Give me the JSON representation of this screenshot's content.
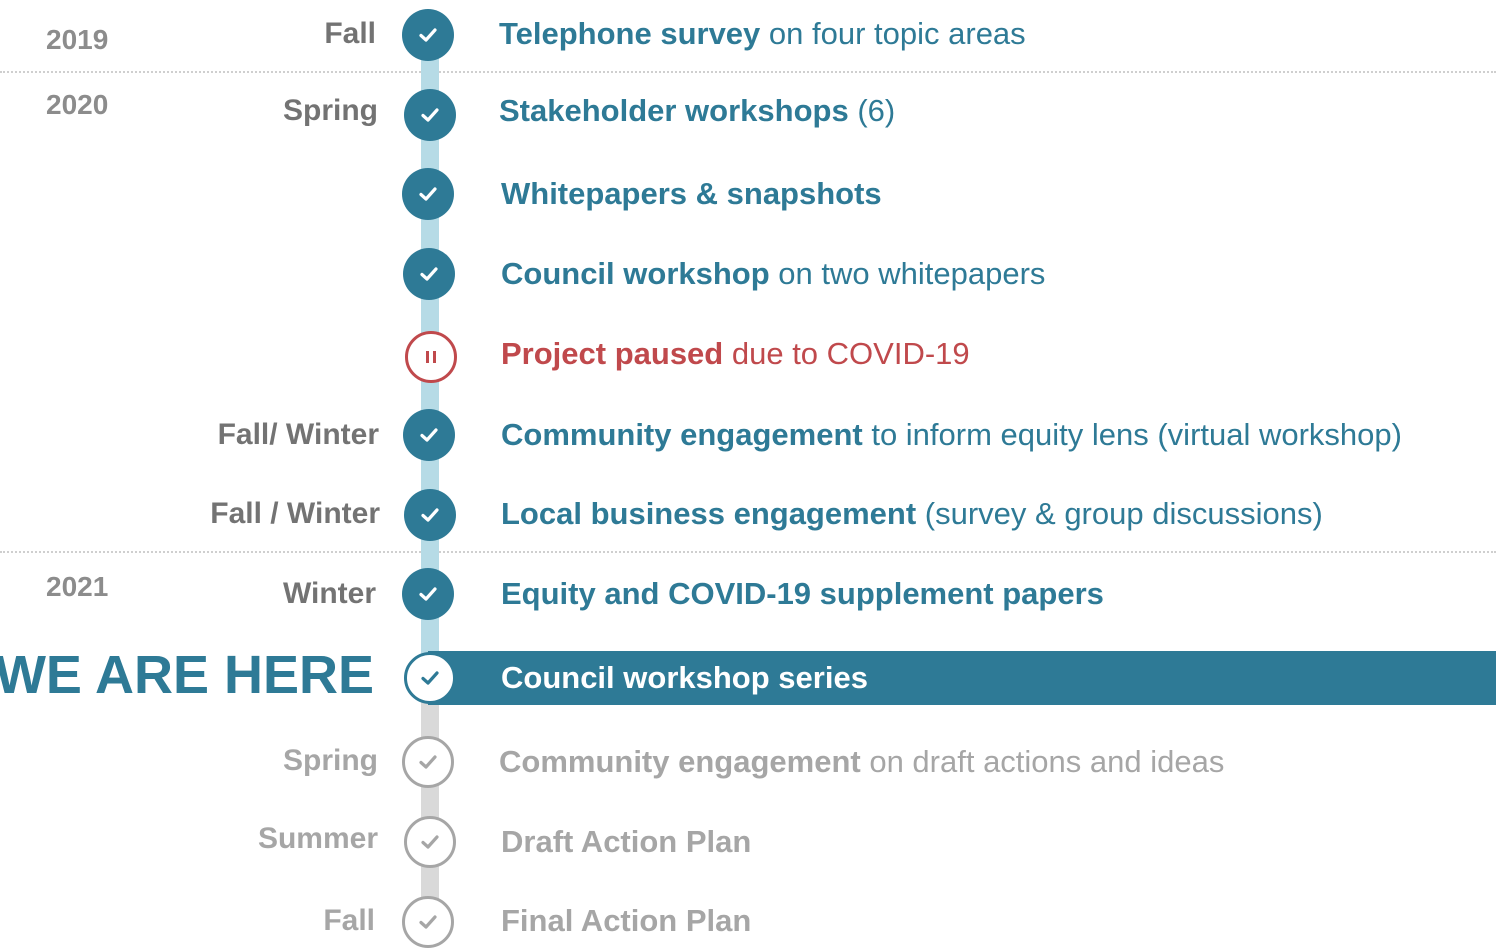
{
  "years": [
    "2019",
    "2020",
    "2021"
  ],
  "seasons": {
    "fall_2019": "Fall",
    "spring_2020": "Spring",
    "fall_winter_a": "Fall/ Winter",
    "fall_winter_b": "Fall / Winter",
    "winter_2021": "Winter",
    "spring_future": "Spring",
    "summer_future": "Summer",
    "fall_future": "Fall"
  },
  "we_are_here": "WE ARE HERE",
  "events": [
    {
      "bold": "Telephone survey",
      "rest": " on four topic areas",
      "status": "done"
    },
    {
      "bold": "Stakeholder workshops",
      "rest": " (6)",
      "status": "done"
    },
    {
      "bold": "Whitepapers & snapshots",
      "rest": "",
      "status": "done"
    },
    {
      "bold": "Council workshop",
      "rest": " on two whitepapers",
      "status": "done"
    },
    {
      "bold": "Project paused",
      "rest": " due to COVID-19",
      "status": "paused"
    },
    {
      "bold": "Community engagement",
      "rest": " to inform equity lens (virtual workshop)",
      "status": "done"
    },
    {
      "bold": "Local business engagement",
      "rest": " (survey & group discussions)",
      "status": "done"
    },
    {
      "bold": "Equity and COVID-19 supplement papers",
      "rest": "",
      "status": "done"
    },
    {
      "bold": "Council workshop series",
      "rest": "",
      "status": "current"
    },
    {
      "bold": "Community engagement",
      "rest": " on draft actions and ideas",
      "status": "future"
    },
    {
      "bold": "Draft Action Plan",
      "rest": "",
      "status": "future"
    },
    {
      "bold": "Final Action Plan",
      "rest": "",
      "status": "future"
    }
  ],
  "colors": {
    "teal": "#2e7a96",
    "rail_done": "#b6dbe6",
    "rail_future": "#d9d9d9",
    "paused_red": "#c0494c",
    "future_gray": "#a6a6a6"
  },
  "icons": {
    "done": "check-circle-icon",
    "paused": "pause-circle-icon",
    "current": "check-circle-outline-icon",
    "future": "check-circle-outline-icon"
  }
}
